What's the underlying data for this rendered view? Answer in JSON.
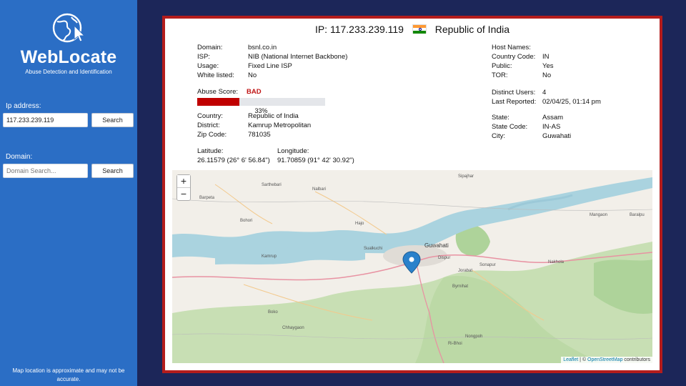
{
  "sidebar": {
    "brand": "WebLocate",
    "tagline": "Abuse Detection and Identification",
    "ip_label": "Ip address:",
    "ip_value": "117.233.239.119",
    "ip_search": "Search",
    "domain_label": "Domain:",
    "domain_placeholder": "Domain Search...",
    "domain_search": "Search",
    "footnote": "Map location is approximate and may not be accurate."
  },
  "panel": {
    "ip_prefix": "IP: 117.233.239.119",
    "country_name": "Republic of India",
    "info_left": [
      {
        "k": "Domain:",
        "v": "bsnl.co.in"
      },
      {
        "k": "ISP:",
        "v": "NIB (National Internet Backbone)"
      },
      {
        "k": "Usage:",
        "v": "Fixed Line ISP"
      },
      {
        "k": "White listed:",
        "v": "No"
      }
    ],
    "abuse": {
      "label": "Abuse Score:",
      "level": "BAD",
      "percent": 33,
      "percent_text": "33%"
    },
    "location_left": [
      {
        "k": "Country:",
        "v": "Republic of India"
      },
      {
        "k": "District:",
        "v": "Kamrup Metropolitan"
      },
      {
        "k": "Zip Code:",
        "v": "781035"
      }
    ],
    "lat": {
      "k": "Latitude:",
      "v": "26.11579 (26° 6' 56.84\")"
    },
    "lon": {
      "k": "Longitude:",
      "v": "91.70859 (91° 42' 30.92\")"
    },
    "info_right": [
      {
        "k": "Host Names:",
        "v": ""
      },
      {
        "k": "Country Code:",
        "v": "IN"
      },
      {
        "k": "Public:",
        "v": "Yes"
      },
      {
        "k": "TOR:",
        "v": "No"
      }
    ],
    "reports": [
      {
        "k": "Distinct Users:",
        "v": "4"
      },
      {
        "k": "Last Reported:",
        "v": "02/04/25, 01:14 pm"
      }
    ],
    "region": [
      {
        "k": "State:",
        "v": "Assam"
      },
      {
        "k": "State Code:",
        "v": "IN-AS"
      },
      {
        "k": "City:",
        "v": "Guwahati"
      }
    ]
  },
  "map": {
    "zoom_in": "+",
    "zoom_out": "−",
    "attribution_leaflet": "Leaflet",
    "attribution_sep": " | © ",
    "attribution_osm": "OpenStreetMap",
    "attribution_tail": " contributors",
    "places": [
      "Barpeta",
      "Nalbari",
      "Sarthebari",
      "Bohori",
      "Hajo",
      "Sualkuchi",
      "Guwahati",
      "Dispur",
      "Kamrup",
      "Sonapur",
      "Nakhola",
      "Jorabat",
      "Byrnihat",
      "Boko",
      "Nongpoh",
      "Mangaon",
      "Sipajhar",
      "Chhaygaon",
      "Ri-Bhoi",
      "Baralpu"
    ]
  }
}
